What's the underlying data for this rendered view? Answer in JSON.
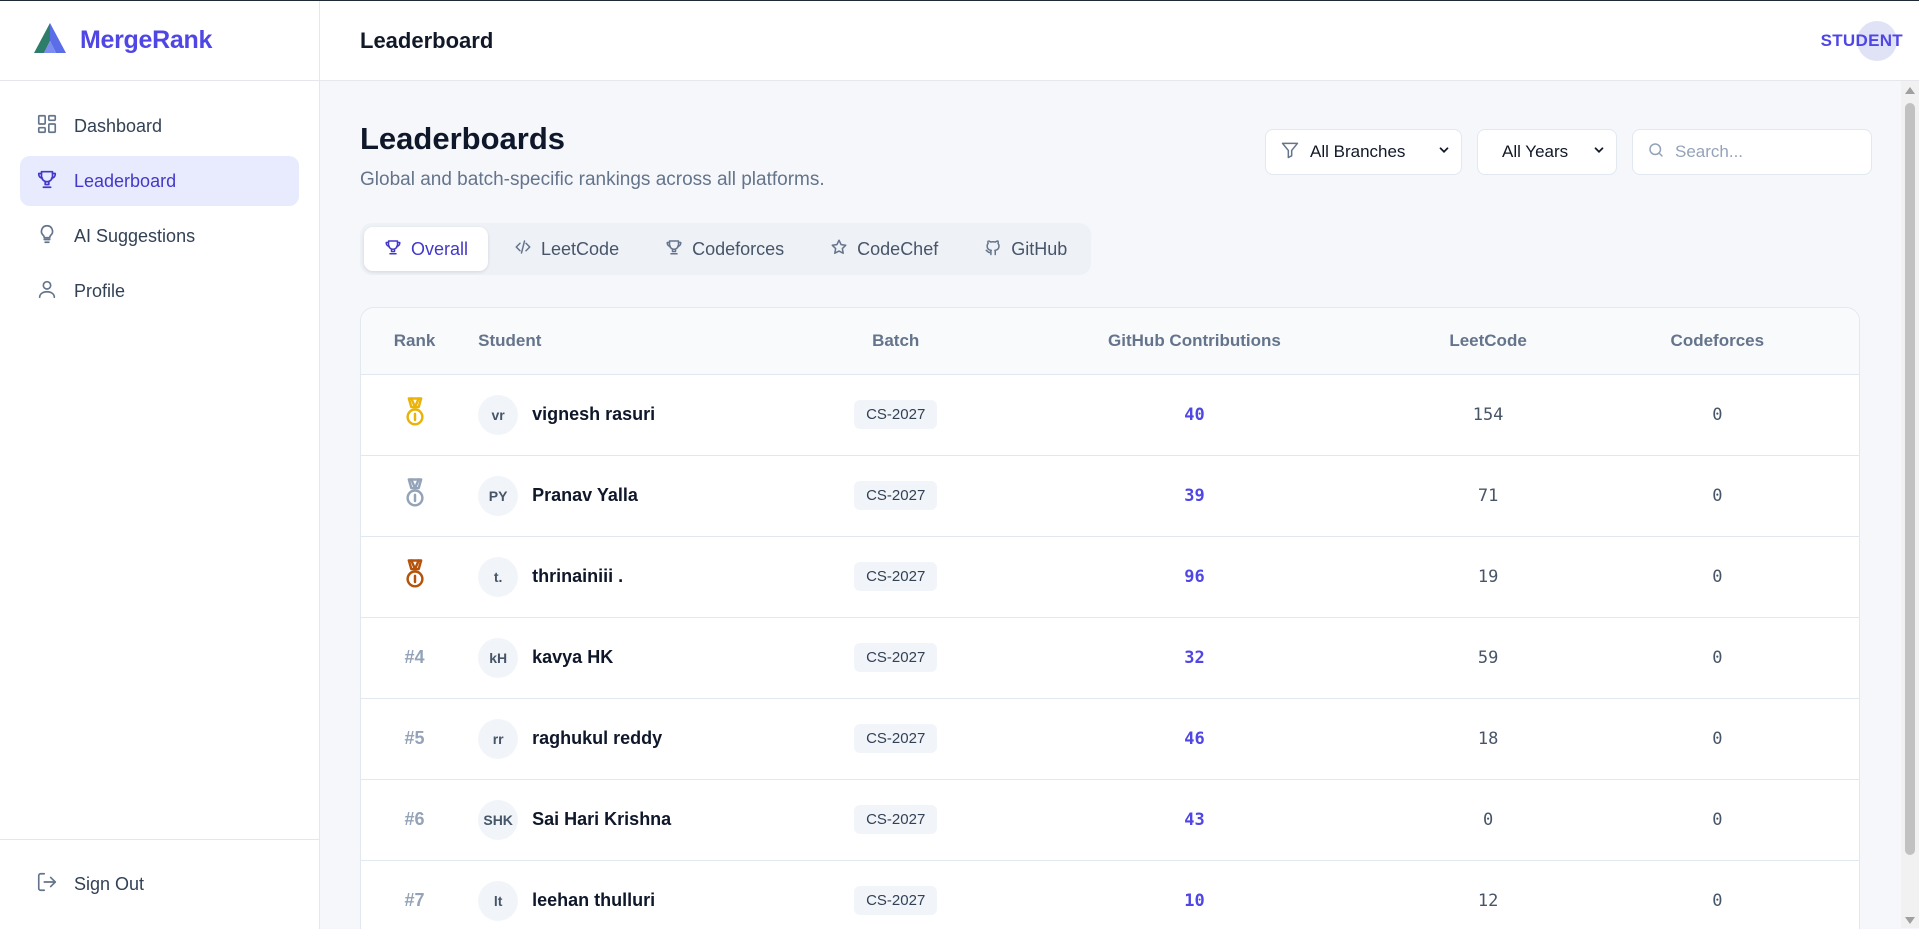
{
  "brand": {
    "name": "MergeRank"
  },
  "sidebar": {
    "items": [
      {
        "label": "Dashboard",
        "icon": "dashboard-icon",
        "active": false
      },
      {
        "label": "Leaderboard",
        "icon": "trophy-icon",
        "active": true
      },
      {
        "label": "AI Suggestions",
        "icon": "lightbulb-icon",
        "active": false
      },
      {
        "label": "Profile",
        "icon": "user-icon",
        "active": false
      }
    ],
    "signout_label": "Sign Out"
  },
  "topbar": {
    "title": "Leaderboard",
    "role": "STUDENT"
  },
  "page": {
    "title": "Leaderboards",
    "subtitle": "Global and batch-specific rankings across all platforms."
  },
  "filters": {
    "branch": "All Branches",
    "year": "All Years",
    "search_placeholder": "Search..."
  },
  "tabs": [
    {
      "label": "Overall",
      "icon": "trophy-icon",
      "active": true
    },
    {
      "label": "LeetCode",
      "icon": "code-icon",
      "active": false
    },
    {
      "label": "Codeforces",
      "icon": "trophy-icon",
      "active": false
    },
    {
      "label": "CodeChef",
      "icon": "star-icon",
      "active": false
    },
    {
      "label": "GitHub",
      "icon": "github-icon",
      "active": false
    }
  ],
  "table": {
    "headers": [
      "Rank",
      "Student",
      "Batch",
      "GitHub Contributions",
      "LeetCode",
      "Codeforces"
    ],
    "rows": [
      {
        "rank": "1",
        "medal": "gold",
        "initials": "vr",
        "name": "vignesh rasuri",
        "batch": "CS-2027",
        "github": "40",
        "leetcode": "154",
        "codeforces": "0"
      },
      {
        "rank": "2",
        "medal": "silver",
        "initials": "PY",
        "name": "Pranav Yalla",
        "batch": "CS-2027",
        "github": "39",
        "leetcode": "71",
        "codeforces": "0"
      },
      {
        "rank": "3",
        "medal": "bronze",
        "initials": "t.",
        "name": "thrinainiii .",
        "batch": "CS-2027",
        "github": "96",
        "leetcode": "19",
        "codeforces": "0"
      },
      {
        "rank": "#4",
        "medal": "",
        "initials": "kH",
        "name": "kavya HK",
        "batch": "CS-2027",
        "github": "32",
        "leetcode": "59",
        "codeforces": "0"
      },
      {
        "rank": "#5",
        "medal": "",
        "initials": "rr",
        "name": "raghukul reddy",
        "batch": "CS-2027",
        "github": "46",
        "leetcode": "18",
        "codeforces": "0"
      },
      {
        "rank": "#6",
        "medal": "",
        "initials": "SHK",
        "name": "Sai Hari Krishna",
        "batch": "CS-2027",
        "github": "43",
        "leetcode": "0",
        "codeforces": "0"
      },
      {
        "rank": "#7",
        "medal": "",
        "initials": "lt",
        "name": "leehan thulluri",
        "batch": "CS-2027",
        "github": "10",
        "leetcode": "12",
        "codeforces": "0"
      }
    ]
  },
  "colors": {
    "accent": "#4f46e5",
    "gold": "#eab308",
    "silver": "#94a3b8",
    "bronze": "#b45309"
  }
}
